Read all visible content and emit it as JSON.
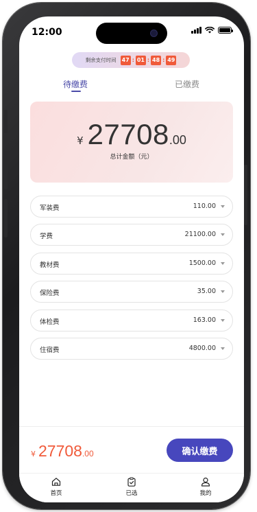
{
  "status_bar": {
    "time": "12:00"
  },
  "countdown": {
    "label": "剩余支付时间",
    "hours": "47",
    "minutes": "01",
    "seconds": "48",
    "centiseconds": "49",
    "separator": ":"
  },
  "tabs": [
    {
      "label": "待缴费",
      "active": true
    },
    {
      "label": "已缴费",
      "active": false
    }
  ],
  "summary": {
    "currency": "¥",
    "amount_integer": "27708",
    "amount_decimal": ".00",
    "caption": "总计金额（元）"
  },
  "fees": [
    {
      "name": "军装费",
      "amount": "110.00"
    },
    {
      "name": "学费",
      "amount": "21100.00"
    },
    {
      "name": "教材费",
      "amount": "1500.00"
    },
    {
      "name": "保险费",
      "amount": "35.00"
    },
    {
      "name": "体检费",
      "amount": "163.00"
    },
    {
      "name": "住宿费",
      "amount": "4800.00"
    }
  ],
  "footer": {
    "currency": "¥",
    "amount_integer": "27708",
    "amount_decimal": ".00",
    "confirm_label": "确认缴费"
  },
  "tabbar": [
    {
      "label": "首页",
      "icon": "home-icon"
    },
    {
      "label": "已选",
      "icon": "clipboard-check-icon"
    },
    {
      "label": "我的",
      "icon": "user-icon"
    }
  ],
  "colors": {
    "accent": "#4747bd",
    "price": "#f05a3a",
    "countdown_cell": "#f05a3a"
  }
}
